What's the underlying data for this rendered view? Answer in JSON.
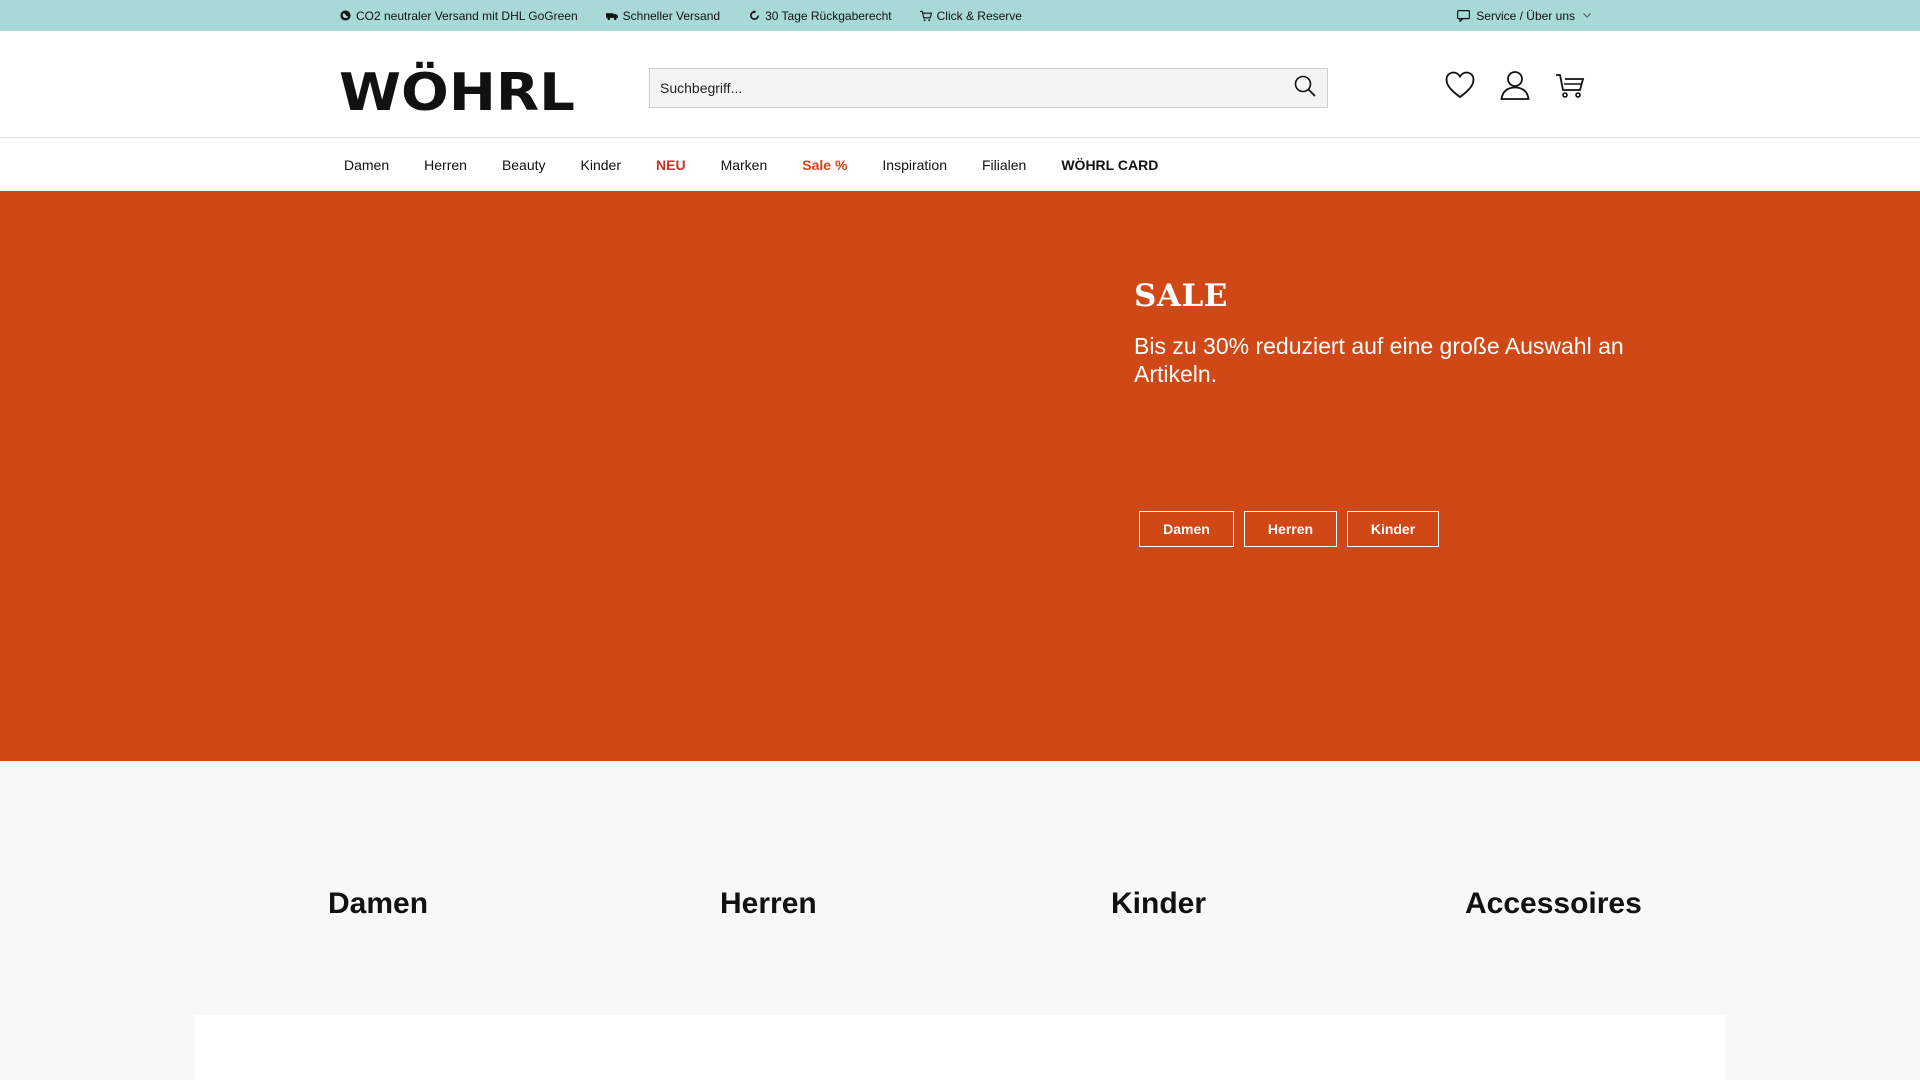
{
  "topbar": {
    "usps": [
      {
        "icon": "globe-icon",
        "label": "CO2 neutraler Versand mit DHL GoGreen"
      },
      {
        "icon": "truck-icon",
        "label": "Schneller Versand"
      },
      {
        "icon": "return-arrow-icon",
        "label": "30 Tage Rückgaberecht"
      },
      {
        "icon": "cart-icon",
        "label": "Click & Reserve"
      }
    ],
    "service_label": "Service / Über uns"
  },
  "header": {
    "logo_text": "WÖHRL",
    "search_placeholder": "Suchbegriff...",
    "search_value": ""
  },
  "nav": {
    "items": [
      {
        "label": "Damen"
      },
      {
        "label": "Herren"
      },
      {
        "label": "Beauty"
      },
      {
        "label": "Kinder"
      },
      {
        "label": "NEU"
      },
      {
        "label": "Marken"
      },
      {
        "label": "Sale %"
      },
      {
        "label": "Inspiration"
      },
      {
        "label": "Filialen"
      },
      {
        "label": "WÖHRL CARD"
      }
    ]
  },
  "hero": {
    "title": "SALE",
    "text": "Bis zu 30% reduziert auf eine große Auswahl an Artikeln.",
    "buttons": [
      {
        "label": "Damen"
      },
      {
        "label": "Herren"
      },
      {
        "label": "Kinder"
      }
    ]
  },
  "categories": {
    "items": [
      {
        "label": "Damen"
      },
      {
        "label": "Herren"
      },
      {
        "label": "Kinder"
      },
      {
        "label": "Accessoires"
      }
    ]
  },
  "colors": {
    "topbar": "#a9d9d6",
    "hero": "#cf4815",
    "neu": "#c8312c",
    "sale": "#d84315"
  }
}
